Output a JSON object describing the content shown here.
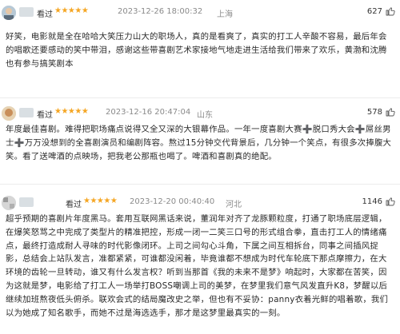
{
  "reviews": [
    {
      "status": "看过",
      "stars": "★★★★★",
      "time": "2023-12-26 18:00:32",
      "location": "上海",
      "likes": "627",
      "text": "好笑，电影就是全在哈哈大笑压力山大的职场人，真的是看爽了，真实的打工人辛酸不容易，最后年会的唱歌还要感动的笑中带泪，感谢这些带喜剧艺术家接地气地走进生活给我们带来了欢乐，黄渤和沈腾也有参与搞笑剧本"
    },
    {
      "status": "看过",
      "stars": "★★★★★",
      "time": "2023-12-16 20:47:04",
      "location": "山东",
      "likes": "578",
      "text": "年度最佳喜剧。难得把职场痛点说得又全又深的大银幕作品。一年一度喜剧大赛➕脱口秀大会➕屌丝男士➕万万没想到的全喜剧演员和编剧阵容。熬过15分钟交代背景后，几分钟一个笑点，有很多次捧腹大笑。看了送啤酒的点映场，把我老公那瓶也喝了。啤酒和喜剧真的绝配。"
    },
    {
      "status": "看过",
      "stars": "★★★★★",
      "time": "2023-12-20 00:40:40",
      "location": "河北",
      "likes": "1146",
      "text": "超乎预期的喜剧片年度黑马。套用互联网黑话来说，董润年对齐了龙豚颗粒度，打通了职场底层逻辑，在爆笑怒骂之中完成了类型片的精准把控，形成一闭一二笑三口号的形式组合拳，直击打工人的情绪痛点，最终打造成耐人寻味的时代影像闭环。上司之间勾心斗角，下属之间互相拆台，同事之间插风捉影，总结会上站队发言，准都紧紧，可谁都没闲着，毕竟谁都不想成为时代车轮底下那点摩擦力，在大环境的齿轮一旦转动，谁又有什么发言权？听到当那首《我的未来不是梦》响起时，大家都在苦笑，因为这就是梦，电影给了打工人一场举打BOSS嘲调上司的美梦，在梦里我们意气风发直升K8，梦醒以后继续加班熬夜低头俯杀。联欢会式的结局魔改史之举，但也有不妥协：panny衣着光鲜的唱着歌，我们以为她成了知名歌手，而她不过是海选选手，那才是这梦里最真实的一刻。"
    }
  ]
}
